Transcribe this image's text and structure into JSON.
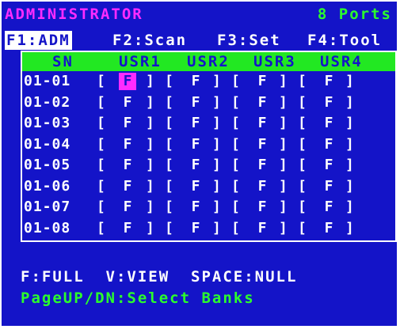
{
  "header": {
    "title": "ADMINISTRATOR",
    "ports": "8 Ports"
  },
  "menu": [
    {
      "label": "F1:ADM",
      "active": true
    },
    {
      "label": "F2:Scan",
      "active": false
    },
    {
      "label": "F3:Set",
      "active": false
    },
    {
      "label": "F4:Tool",
      "active": false
    }
  ],
  "table": {
    "columns": [
      "SN",
      "USR1",
      "USR2",
      "USR3",
      "USR4"
    ],
    "rows": [
      {
        "sn": "01-01",
        "values": [
          "F",
          "F",
          "F",
          "F"
        ]
      },
      {
        "sn": "01-02",
        "values": [
          "F",
          "F",
          "F",
          "F"
        ]
      },
      {
        "sn": "01-03",
        "values": [
          "F",
          "F",
          "F",
          "F"
        ]
      },
      {
        "sn": "01-04",
        "values": [
          "F",
          "F",
          "F",
          "F"
        ]
      },
      {
        "sn": "01-05",
        "values": [
          "F",
          "F",
          "F",
          "F"
        ]
      },
      {
        "sn": "01-06",
        "values": [
          "F",
          "F",
          "F",
          "F"
        ]
      },
      {
        "sn": "01-07",
        "values": [
          "F",
          "F",
          "F",
          "F"
        ]
      },
      {
        "sn": "01-08",
        "values": [
          "F",
          "F",
          "F",
          "F"
        ]
      }
    ],
    "selected": {
      "row": 0,
      "col": 0
    }
  },
  "legend": {
    "line1": "F:FULL  V:VIEW  SPACE:NULL",
    "line2": "PageUP/DN:Select Banks"
  },
  "colors": {
    "background": "#1414c8",
    "header_bar": "#22e822",
    "title": "#ff2bff",
    "ports": "#2bff2b",
    "selection": "#ff2bff"
  }
}
